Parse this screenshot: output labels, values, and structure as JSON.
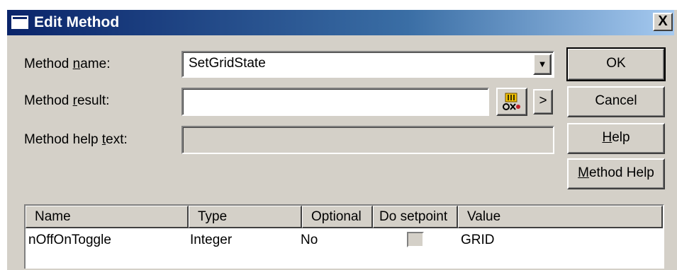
{
  "window": {
    "title": "Edit Method",
    "close_glyph": "X",
    "title_icon": "window-icon"
  },
  "form": {
    "method_name": {
      "label_before": "Method ",
      "label_underlined": "n",
      "label_after": "ame:",
      "value": "SetGridState",
      "dropdown_glyph": "▼"
    },
    "method_result": {
      "label_before": "Method ",
      "label_underlined": "r",
      "label_after": "esult:",
      "value": "",
      "expression_icon": "expression-builder-icon",
      "arrow_glyph": ">"
    },
    "method_help_text": {
      "label_before": "Method help ",
      "label_underlined": "t",
      "label_after": "ext:",
      "value": ""
    }
  },
  "buttons": {
    "ok": "OK",
    "cancel": "Cancel",
    "help_underlined": "H",
    "help_rest": "elp",
    "method_help_underlined": "M",
    "method_help_rest": "ethod Help"
  },
  "params_table": {
    "columns": [
      "Name",
      "Type",
      "Optional",
      "Do setpoint",
      "Value"
    ],
    "rows": [
      {
        "name": "nOffOnToggle",
        "type": "Integer",
        "optional": "No",
        "do_setpoint": false,
        "value": "GRID"
      }
    ]
  },
  "colors": {
    "dialog_face": "#d4d0c8",
    "titlebar_start": "#0a246a",
    "titlebar_end": "#a6caf0"
  }
}
